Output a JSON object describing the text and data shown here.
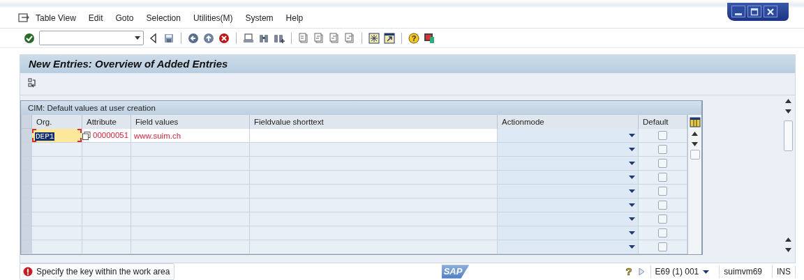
{
  "menu": [
    {
      "label": "Table View"
    },
    {
      "label": "Edit"
    },
    {
      "label": "Goto"
    },
    {
      "label": "Selection"
    },
    {
      "label": "Utilities(M)"
    },
    {
      "label": "System"
    },
    {
      "label": "Help"
    }
  ],
  "toolbar": {
    "help_glyph": "?"
  },
  "screen_title": "New Entries: Overview of Added Entries",
  "table": {
    "title": "CIM: Default values at user creation",
    "columns": [
      "Org.",
      "Attribute",
      "Field values",
      "Fieldvalue shorttext",
      "Actionmode",
      "Default"
    ],
    "rows": [
      {
        "focused": true,
        "org": "DEP1",
        "attribute": "00000051",
        "field_values": "www.suim.ch",
        "default": false
      },
      {
        "focused": false,
        "default": false
      },
      {
        "focused": false,
        "default": false
      },
      {
        "focused": false,
        "default": false
      },
      {
        "focused": false,
        "default": false
      },
      {
        "focused": false,
        "default": false
      },
      {
        "focused": false,
        "default": false
      },
      {
        "focused": false,
        "default": false
      },
      {
        "focused": false,
        "default": false
      }
    ]
  },
  "status_bar": {
    "help_glyph": "?",
    "kind": "error",
    "message": "Specify the key within the work area",
    "logo": "SAP",
    "system": "E69 (1) 001",
    "server": "suimvm69",
    "mode": "INS"
  }
}
